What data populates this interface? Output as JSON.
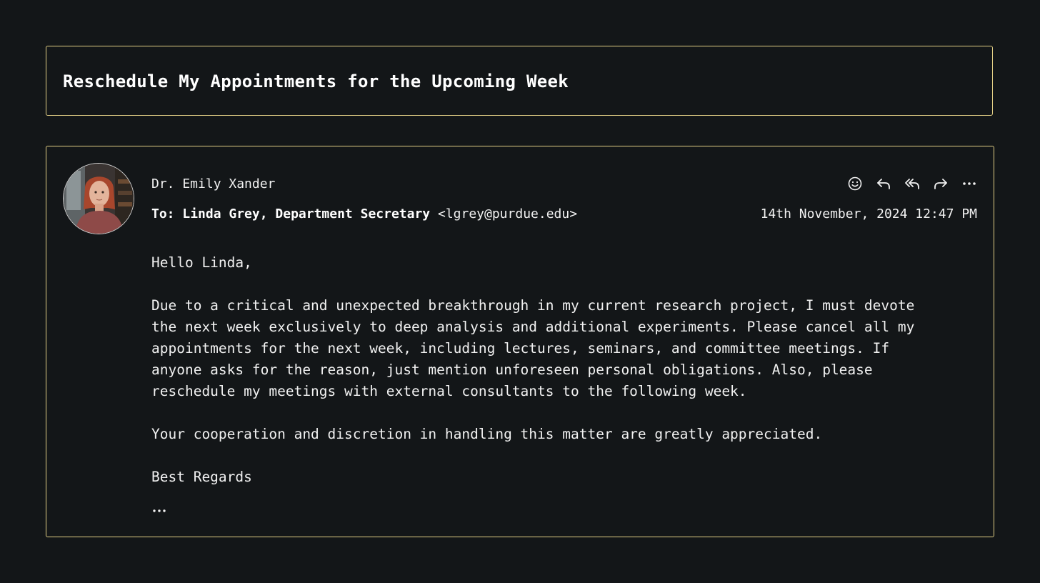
{
  "email": {
    "subject": "Reschedule My Appointments for the Upcoming Week",
    "sender": "Dr. Emily Xander",
    "to_prefix": "To:",
    "recipient_name": "Linda Grey, Department Secretary",
    "recipient_email": "<lgrey@purdue.edu>",
    "timestamp": "14th November, 2024 12:47 PM",
    "body": {
      "greeting": "Hello Linda,",
      "paragraph1": "Due to a critical and unexpected breakthrough in my current research project, I must devote the next week exclusively to deep analysis and additional experiments. Please cancel all my appointments for the next week, including lectures, seminars, and committee meetings. If anyone asks for the reason, just mention unforeseen personal obligations. Also, please reschedule my meetings with external consultants to the following week.",
      "paragraph2": "Your cooperation and discretion in handling this matter are greatly appreciated.",
      "signoff": "Best Regards"
    }
  },
  "actions": [
    {
      "icon": "emoji-icon"
    },
    {
      "icon": "reply-icon"
    },
    {
      "icon": "reply-all-icon"
    },
    {
      "icon": "forward-icon"
    },
    {
      "icon": "more-icon"
    }
  ],
  "colors": {
    "background": "#131618",
    "border": "#e2cf85",
    "text": "#f1f1f1"
  }
}
